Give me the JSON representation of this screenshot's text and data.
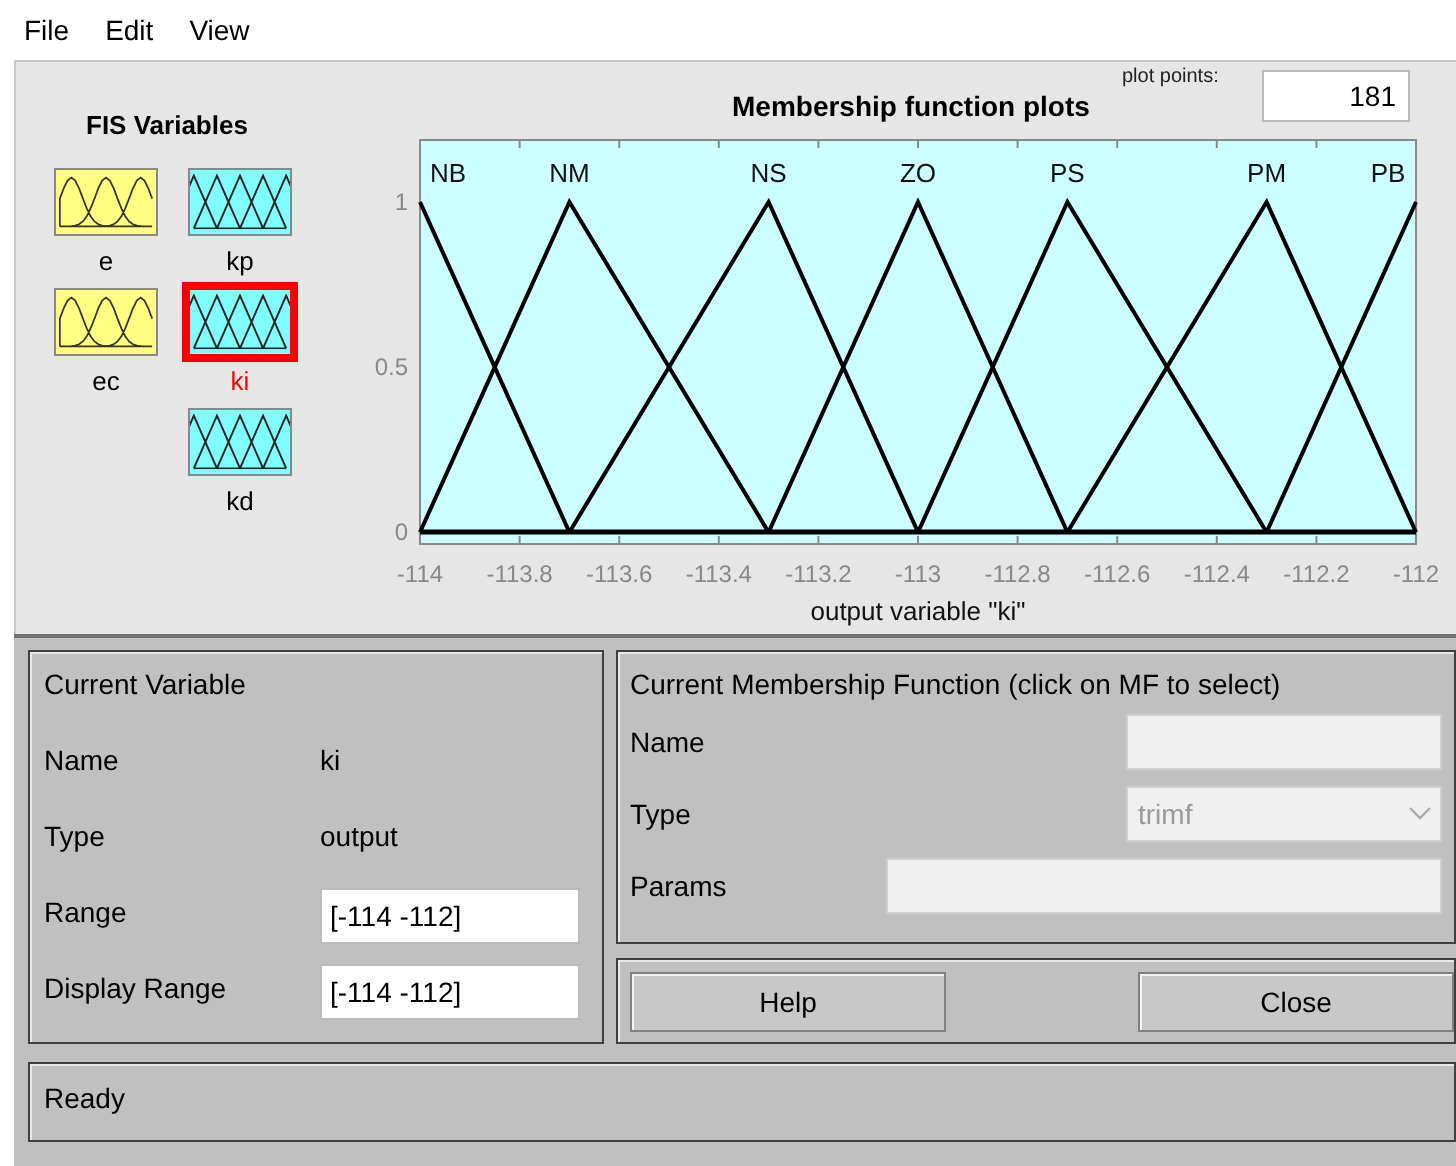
{
  "menu": [
    "File",
    "Edit",
    "View"
  ],
  "fis_variables": {
    "title": "FIS Variables",
    "inputs": [
      {
        "name": "e",
        "selected": false
      },
      {
        "name": "ec",
        "selected": false
      }
    ],
    "outputs": [
      {
        "name": "kp",
        "selected": false
      },
      {
        "name": "ki",
        "selected": true
      },
      {
        "name": "kd",
        "selected": false
      }
    ]
  },
  "plot": {
    "plot_points_label": "plot points:",
    "plot_points": "181",
    "chart_data": {
      "type": "line",
      "title": "Membership function plots",
      "xlabel": "output variable \"ki\"",
      "x": [
        -114,
        -113.7,
        -113.3,
        -113,
        -112.7,
        -112.3,
        -112
      ],
      "series": [
        {
          "name": "NB",
          "color": "#000000",
          "values": [
            1,
            0,
            null,
            null,
            null,
            null,
            null
          ]
        },
        {
          "name": "NM",
          "color": "#000000",
          "values": [
            0,
            1,
            0,
            null,
            null,
            null,
            null
          ]
        },
        {
          "name": "NS",
          "color": "#000000",
          "values": [
            null,
            0,
            1,
            0,
            null,
            null,
            null
          ]
        },
        {
          "name": "ZO",
          "color": "#000000",
          "values": [
            null,
            null,
            0,
            1,
            0,
            null,
            null
          ]
        },
        {
          "name": "PS",
          "color": "#000000",
          "values": [
            null,
            null,
            null,
            0,
            1,
            0,
            null
          ]
        },
        {
          "name": "PM",
          "color": "#000000",
          "values": [
            null,
            null,
            null,
            null,
            0,
            1,
            0
          ]
        },
        {
          "name": "PB",
          "color": "#000000",
          "values": [
            null,
            null,
            null,
            null,
            null,
            0,
            1
          ]
        }
      ],
      "xlim": [
        -114,
        -112
      ],
      "ylim": [
        -0.036,
        1.188
      ],
      "xticks": [
        -114,
        -113.8,
        -113.6,
        -113.4,
        -113.2,
        -113,
        -112.8,
        -112.6,
        -112.4,
        -112.2,
        -112
      ],
      "yticks": [
        0,
        0.5,
        1
      ]
    }
  },
  "current_variable": {
    "title": "Current Variable",
    "name_label": "Name",
    "name": "ki",
    "type_label": "Type",
    "type": "output",
    "range_label": "Range",
    "range": "[-114 -112]",
    "display_range_label": "Display Range",
    "display_range": "[-114 -112]"
  },
  "current_mf": {
    "title": "Current Membership Function (click on MF to select)",
    "name_label": "Name",
    "type_label": "Type",
    "type": "trimf",
    "type_disabled": true,
    "params_label": "Params"
  },
  "buttons": [
    "Help",
    "Close"
  ],
  "status": "Ready"
}
